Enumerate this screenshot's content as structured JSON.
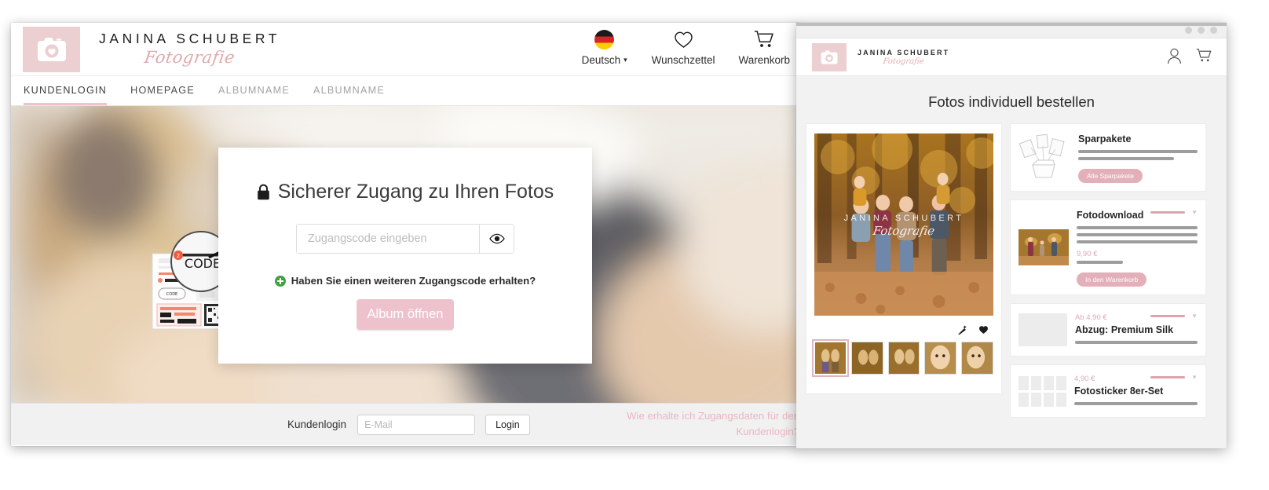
{
  "window1": {
    "brand": {
      "name": "JANINA SCHUBERT",
      "tagline": "Fotografie",
      "logo_icon": "camera-heart-icon"
    },
    "nav_right": [
      {
        "icon": "german-flag-icon",
        "label": "Deutsch",
        "caret": "▾"
      },
      {
        "icon": "heart-icon",
        "label": "Wunschzettel"
      },
      {
        "icon": "shopping-cart-icon",
        "label": "Warenkorb"
      }
    ],
    "tabs": [
      {
        "label": "KUNDENLOGIN",
        "active": true
      },
      {
        "label": "HOMEPAGE",
        "active": false
      },
      {
        "label": "ALBUMNAME",
        "active": false
      },
      {
        "label": "ALBUMNAME",
        "active": false
      }
    ],
    "login_card": {
      "lock_icon": "lock-icon",
      "title": "Sicherer Zugang zu Ihren Fotos",
      "code_placeholder": "Zugangscode eingeben",
      "code_value": "",
      "eye_icon": "eye-icon",
      "extra_code_link": "Haben Sie einen weiteren Zugangscode erhalten?",
      "plus_icon": "plus-circle-icon",
      "open_button": "Album öffnen"
    },
    "code_illustration": {
      "magnifier_label": "CODE",
      "badge": "2"
    },
    "footer": {
      "label": "Kundenlogin",
      "email_placeholder": "E-Mail",
      "email_value": "",
      "login_button": "Login",
      "help_link": "Wie erhalte ich Zugangsdaten für den Kundenlogin?"
    }
  },
  "window2": {
    "chrome": {
      "dots": 3
    },
    "brand": {
      "name": "JANINA SCHUBERT",
      "tagline": "Fotografie",
      "logo_icon": "camera-heart-icon"
    },
    "header_icons": [
      {
        "icon": "user-account-icon"
      },
      {
        "icon": "shopping-cart-icon"
      }
    ],
    "page_title": "Fotos individuell bestellen",
    "viewer": {
      "watermark_line1": "JANINA SCHUBERT",
      "watermark_line2": "Fotografie",
      "tools": [
        {
          "icon": "magic-wand-icon"
        },
        {
          "icon": "heart-icon"
        }
      ],
      "thumbnails": [
        {
          "selected": true
        },
        {
          "selected": false
        },
        {
          "selected": false
        },
        {
          "selected": false
        },
        {
          "selected": false
        }
      ]
    },
    "products": [
      {
        "title": "Sparpakete",
        "price": "",
        "thumb": "gift-box-photos-icon",
        "skeleton_lines": 2,
        "button": "Alle Sparpakete",
        "has_pinkline": false,
        "has_chevron": false
      },
      {
        "title": "Fotodownload",
        "price": "9,90 €",
        "thumb": "photo-thumb",
        "skeleton_lines": 3,
        "button": "In den Warenkorb",
        "has_pinkline": true,
        "has_chevron": true
      },
      {
        "title": "Abzug: Premium Silk",
        "price": "Ab 4,90 €",
        "thumb": "gray-rect",
        "skeleton_lines": 1,
        "button": "",
        "has_pinkline": true,
        "has_chevron": true
      },
      {
        "title": "Fotosticker 8er-Set",
        "price": "4,90 €",
        "thumb": "sticker-grid",
        "skeleton_lines": 1,
        "button": "",
        "has_pinkline": true,
        "has_chevron": true
      }
    ]
  },
  "colors": {
    "brand_pink": "#eec2cd",
    "brand_pink_dark": "#e0a3ae",
    "logo_bg": "#eccfd0",
    "accent_green": "#3ca43c",
    "text_dark": "#2b2b2b",
    "muted": "#a3a3a3",
    "footer_bg": "#f1f1f1"
  }
}
